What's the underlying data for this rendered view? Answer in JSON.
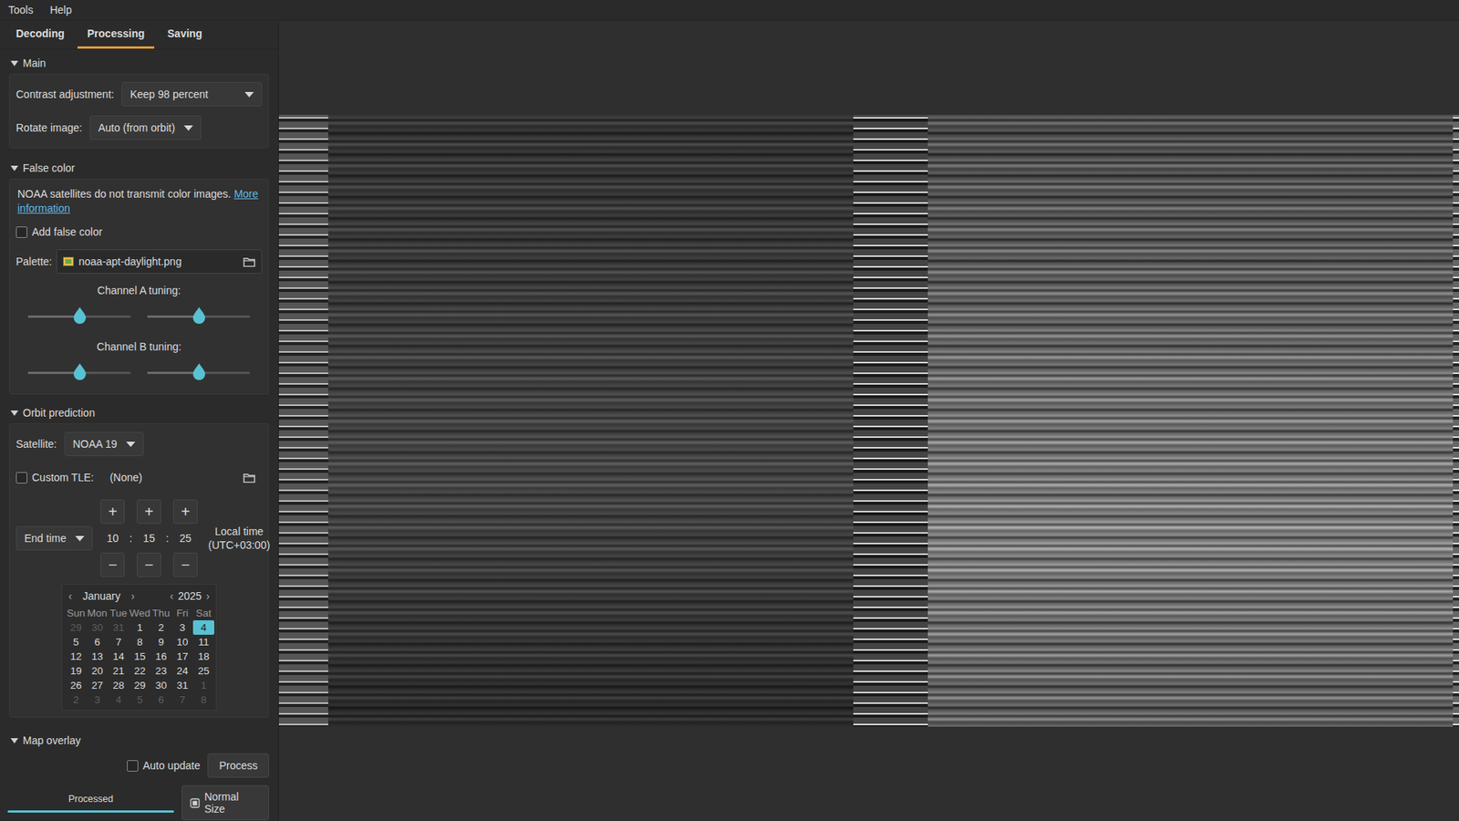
{
  "menu": [
    {
      "label": "Tools"
    },
    {
      "label": "Help"
    }
  ],
  "tabs": [
    {
      "label": "Decoding",
      "selected": false
    },
    {
      "label": "Processing",
      "selected": true
    },
    {
      "label": "Saving",
      "selected": false
    }
  ],
  "main": {
    "title": "Main",
    "expanded": true,
    "contrast_label": "Contrast adjustment:",
    "contrast_value": "Keep 98 percent",
    "rotate_label": "Rotate image:",
    "rotate_value": "Auto (from orbit)"
  },
  "false_color": {
    "title": "False color",
    "expanded": true,
    "info": "NOAA satellites do not transmit color images.",
    "link": "More information",
    "add_label": "Add false color",
    "add_checked": false,
    "palette_label": "Palette:",
    "palette_value": "noaa-apt-daylight.png",
    "tunings": [
      {
        "label": "Channel A tuning:",
        "sliders": [
          {
            "level": 0.5
          },
          {
            "level": 0.5
          }
        ]
      },
      {
        "label": "Channel B tuning:",
        "sliders": [
          {
            "level": 0.5
          },
          {
            "level": 0.5
          }
        ]
      }
    ]
  },
  "orbit": {
    "title": "Orbit prediction",
    "expanded": true,
    "satellite_label": "Satellite:",
    "satellite_value": "NOAA 19",
    "custom_tle_label": "Custom TLE:",
    "custom_tle_checked": false,
    "tle_value": "(None)",
    "time_mode": "End time",
    "time": [
      {
        "value": "10",
        "plus": "+",
        "minus": "−"
      },
      {
        "value": "15",
        "plus": "+",
        "minus": "−"
      },
      {
        "value": "25",
        "plus": "+",
        "minus": "−"
      }
    ],
    "separators": [
      ":",
      ":"
    ],
    "tz": [
      "Local time",
      "(UTC+03:00)"
    ],
    "calendar": {
      "month": "January",
      "year": "2025",
      "prev": "‹",
      "next": "›",
      "weekdays": [
        "Sun",
        "Mon",
        "Tue",
        "Wed",
        "Thu",
        "Fri",
        "Sat"
      ],
      "weeks": [
        [
          {
            "day": "29",
            "in_month": false,
            "selected": false
          },
          {
            "day": "30",
            "in_month": false,
            "selected": false
          },
          {
            "day": "31",
            "in_month": false,
            "selected": false
          },
          {
            "day": "1",
            "in_month": true,
            "selected": false
          },
          {
            "day": "2",
            "in_month": true,
            "selected": false
          },
          {
            "day": "3",
            "in_month": true,
            "selected": false
          },
          {
            "day": "4",
            "in_month": true,
            "selected": true
          }
        ],
        [
          {
            "day": "5",
            "in_month": true,
            "selected": false
          },
          {
            "day": "6",
            "in_month": true,
            "selected": false
          },
          {
            "day": "7",
            "in_month": true,
            "selected": false
          },
          {
            "day": "8",
            "in_month": true,
            "selected": false
          },
          {
            "day": "9",
            "in_month": true,
            "selected": false
          },
          {
            "day": "10",
            "in_month": true,
            "selected": false
          },
          {
            "day": "11",
            "in_month": true,
            "selected": false
          }
        ],
        [
          {
            "day": "12",
            "in_month": true,
            "selected": false
          },
          {
            "day": "13",
            "in_month": true,
            "selected": false
          },
          {
            "day": "14",
            "in_month": true,
            "selected": false
          },
          {
            "day": "15",
            "in_month": true,
            "selected": false
          },
          {
            "day": "16",
            "in_month": true,
            "selected": false
          },
          {
            "day": "17",
            "in_month": true,
            "selected": false
          },
          {
            "day": "18",
            "in_month": true,
            "selected": false
          }
        ],
        [
          {
            "day": "19",
            "in_month": true,
            "selected": false
          },
          {
            "day": "20",
            "in_month": true,
            "selected": false
          },
          {
            "day": "21",
            "in_month": true,
            "selected": false
          },
          {
            "day": "22",
            "in_month": true,
            "selected": false
          },
          {
            "day": "23",
            "in_month": true,
            "selected": false
          },
          {
            "day": "24",
            "in_month": true,
            "selected": false
          },
          {
            "day": "25",
            "in_month": true,
            "selected": false
          }
        ],
        [
          {
            "day": "26",
            "in_month": true,
            "selected": false
          },
          {
            "day": "27",
            "in_month": true,
            "selected": false
          },
          {
            "day": "28",
            "in_month": true,
            "selected": false
          },
          {
            "day": "29",
            "in_month": true,
            "selected": false
          },
          {
            "day": "30",
            "in_month": true,
            "selected": false
          },
          {
            "day": "31",
            "in_month": true,
            "selected": false
          },
          {
            "day": "1",
            "in_month": false,
            "selected": false
          }
        ],
        [
          {
            "day": "2",
            "in_month": false,
            "selected": false
          },
          {
            "day": "3",
            "in_month": false,
            "selected": false
          },
          {
            "day": "4",
            "in_month": false,
            "selected": false
          },
          {
            "day": "5",
            "in_month": false,
            "selected": false
          },
          {
            "day": "6",
            "in_month": false,
            "selected": false
          },
          {
            "day": "7",
            "in_month": false,
            "selected": false
          },
          {
            "day": "8",
            "in_month": false,
            "selected": false
          }
        ]
      ]
    }
  },
  "map_overlay": {
    "title": "Map overlay",
    "expanded": true
  },
  "auto_update": {
    "label": "Auto update",
    "checked": false
  },
  "process_button": "Process",
  "progress": {
    "label": "Processed",
    "level": 1
  },
  "normal_size": {
    "label": "Normal Size"
  }
}
